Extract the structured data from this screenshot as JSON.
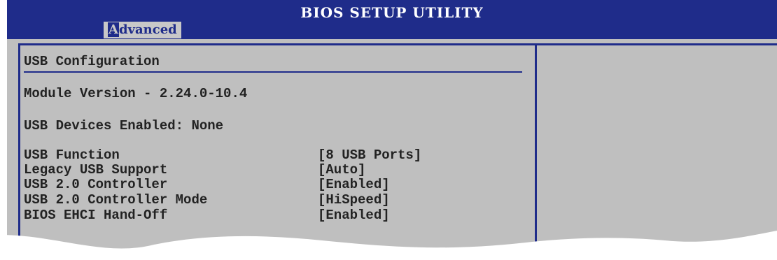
{
  "window": {
    "title": "BIOS SETUP UTILITY"
  },
  "tabs": [
    {
      "label_first": "A",
      "label_rest": "dvanced"
    }
  ],
  "section": {
    "heading": "USB Configuration",
    "module_version": "Module Version - 2.24.0-10.4",
    "devices_enabled": "USB Devices Enabled: None"
  },
  "settings": [
    {
      "label": "USB Function",
      "value": "[8 USB Ports]"
    },
    {
      "label": "Legacy USB Support",
      "value": "[Auto]"
    },
    {
      "label": "USB 2.0 Controller",
      "value": "[Enabled]"
    },
    {
      "label": "USB 2.0 Controller Mode",
      "value": "[HiSpeed]"
    },
    {
      "label": "BIOS EHCI Hand-Off",
      "value": "[Enabled]"
    }
  ],
  "colors": {
    "bar": "#1f2c8a",
    "panel": "#bfbfbf",
    "text": "#222222"
  }
}
